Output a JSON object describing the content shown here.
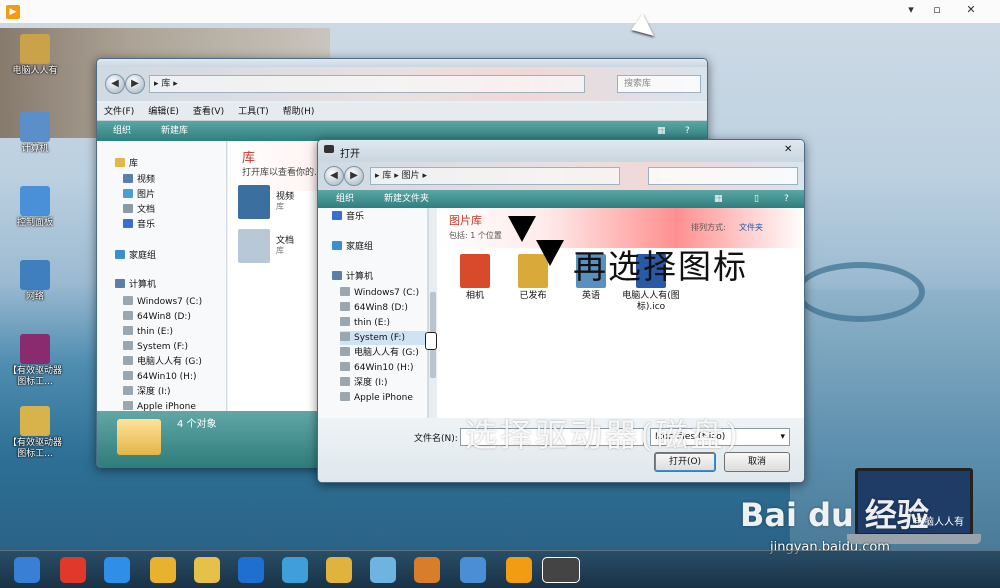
{
  "desktop_icons": [
    {
      "label": "电脑人人有",
      "color": "#c9a24a"
    },
    {
      "label": "计算机",
      "color": "#5b8fc9"
    },
    {
      "label": "控制面板",
      "color": "#4a90d9"
    },
    {
      "label": "网络",
      "color": "#3f7fbf"
    },
    {
      "label": "【有效驱动器图标工...",
      "color": "#8a2a6f"
    },
    {
      "label": "【有效驱动器图标工...",
      "color": "#d8b24a"
    }
  ],
  "explorer": {
    "search_placeholder": "搜索库",
    "address_crumb": "库",
    "menu": [
      "文件(F)",
      "编辑(E)",
      "查看(V)",
      "工具(T)",
      "帮助(H)"
    ],
    "cmd_organize": "组织",
    "cmd_new_library": "新建库",
    "nav": {
      "libraries": "库",
      "lib_items": [
        "视频",
        "图片",
        "文档",
        "音乐"
      ],
      "homegroup": "家庭组",
      "computer": "计算机",
      "drives": [
        "Windows7 (C:)",
        "64Win8 (D:)",
        "thin (E:)",
        "System (F:)",
        "电脑人人有 (G:)",
        "64Win10 (H:)",
        "深度 (I:)",
        "Apple iPhone"
      ]
    },
    "header_title": "库",
    "header_sub": "打开库以查看你的...",
    "items": [
      {
        "name": "视频",
        "sub": "库"
      },
      {
        "name": "文档",
        "sub": "库"
      }
    ],
    "status_count": "4 个对象"
  },
  "open_dialog": {
    "title": "打开",
    "crumbs": [
      "库",
      "图片"
    ],
    "cmd_organize": "组织",
    "cmd_new_folder": "新建文件夹",
    "nav": {
      "music": "音乐",
      "homegroup": "家庭组",
      "computer": "计算机",
      "drives": [
        "Windows7 (C:)",
        "64Win8 (D:)",
        "thin (E:)",
        "System (F:)",
        "电脑人人有 (G:)",
        "64Win10 (H:)",
        "深度 (I:)",
        "Apple iPhone"
      ]
    },
    "lib_title": "图片库",
    "lib_sub": "包括: 1 个位置",
    "arrange_label": "排列方式:",
    "arrange_value": "文件夹",
    "files": [
      {
        "name": "相机",
        "color": "#d94a2a"
      },
      {
        "name": "已发布",
        "color": "#d9a93a"
      },
      {
        "name": "英语",
        "color": "#5a8fc2"
      },
      {
        "name": "电脑人人有(图标).ico",
        "color": "#2a5aa6"
      }
    ],
    "filename_label": "文件名(N):",
    "filetype_value": "Icon files (*.ico)",
    "open_button": "打开(O)",
    "cancel_button": "取消"
  },
  "overlay": {
    "choose_icon": "再选择图标",
    "choose_drive": "选择驱动器(磁盘)"
  },
  "watermark": {
    "brand": "Bai du 经验",
    "url": "jingyan.baidu.com",
    "laptop_text": "电脑人人有"
  },
  "taskbar_items": [
    {
      "name": "start",
      "color": "#3a7fd6"
    },
    {
      "name": "app-red",
      "color": "#e0392b"
    },
    {
      "name": "ie",
      "color": "#2e8ee8"
    },
    {
      "name": "chrome",
      "color": "#e8b22e"
    },
    {
      "name": "folder-stack",
      "color": "#e6c14a"
    },
    {
      "name": "browser-blue",
      "color": "#1f6fd1"
    },
    {
      "name": "network",
      "color": "#3f9fd8"
    },
    {
      "name": "explorer",
      "color": "#e0b43c"
    },
    {
      "name": "fan",
      "color": "#6fb3e0"
    },
    {
      "name": "paint",
      "color": "#d87e2a"
    },
    {
      "name": "media",
      "color": "#4a8fd6"
    },
    {
      "name": "player",
      "color": "#f39c12"
    },
    {
      "name": "drive-active",
      "color": "#444444"
    }
  ]
}
